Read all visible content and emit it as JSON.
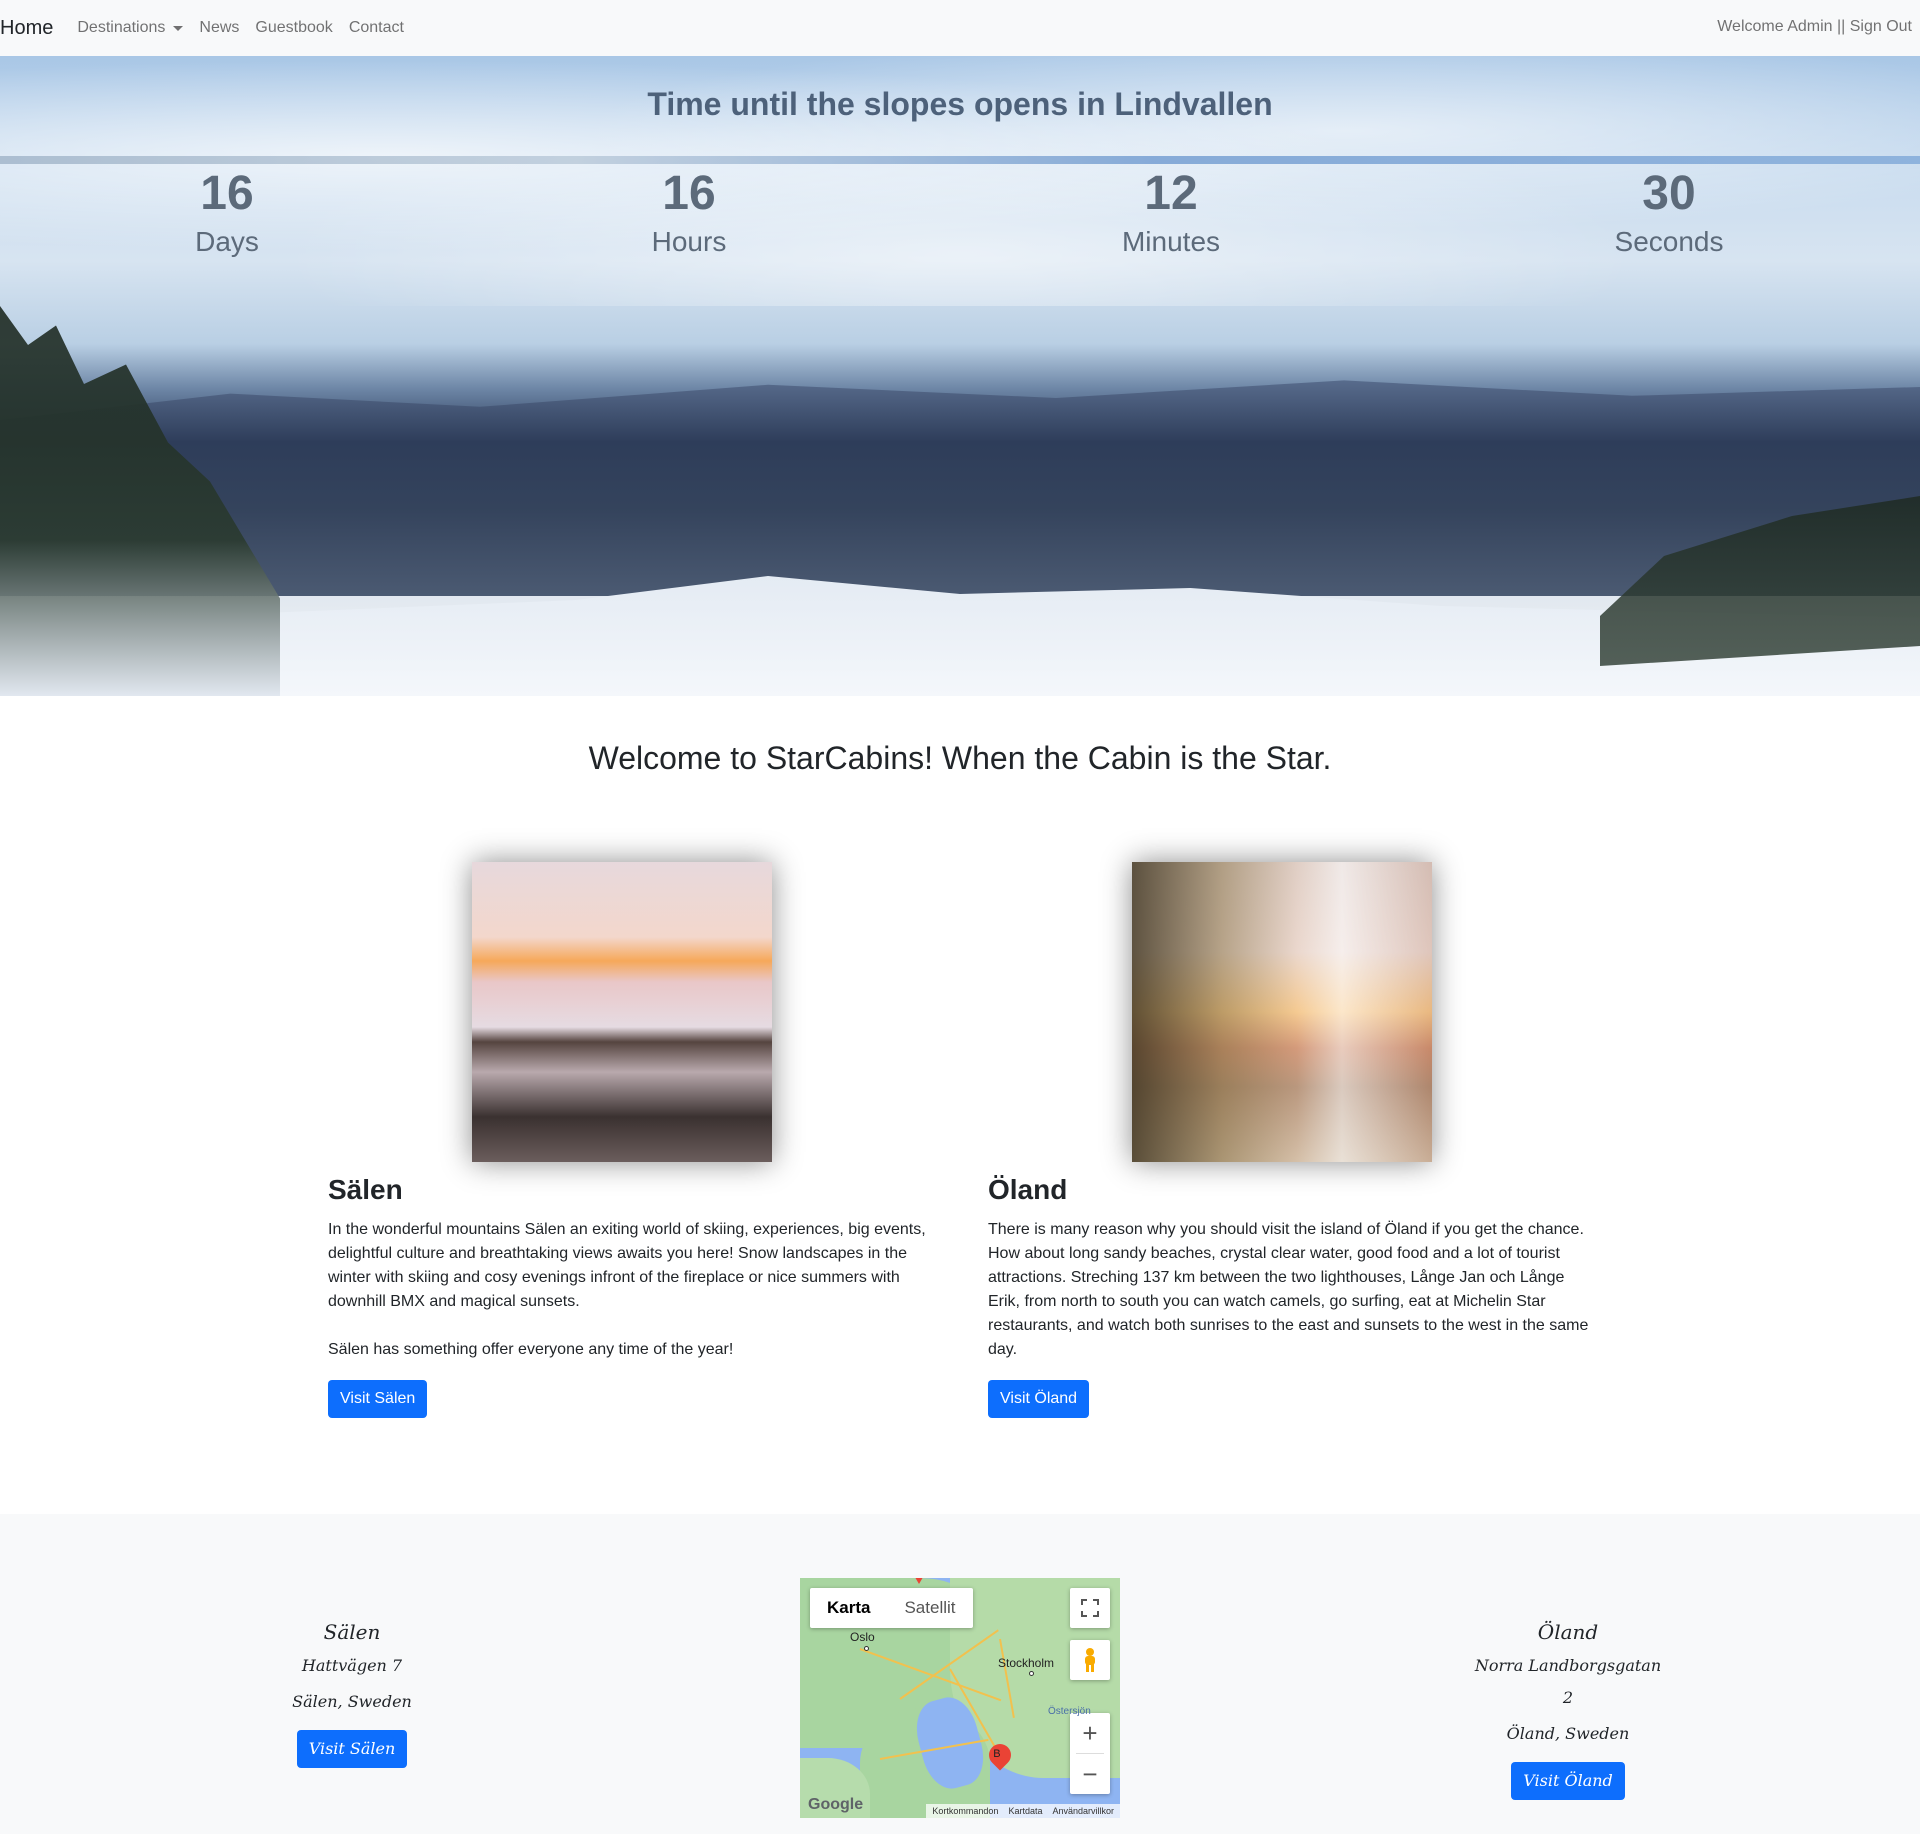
{
  "nav": {
    "brand": "Home",
    "items": [
      {
        "label": "Destinations",
        "dropdown": true
      },
      {
        "label": "News"
      },
      {
        "label": "Guestbook"
      },
      {
        "label": "Contact"
      }
    ],
    "right_text": "Welcome Admin || Sign Out"
  },
  "hero": {
    "title": "Time until the slopes opens in Lindvallen",
    "countdown": [
      {
        "value": "16",
        "label": "Days"
      },
      {
        "value": "16",
        "label": "Hours"
      },
      {
        "value": "12",
        "label": "Minutes"
      },
      {
        "value": "30",
        "label": "Seconds"
      }
    ]
  },
  "welcome": "Welcome to StarCabins! When the Cabin is the Star.",
  "destinations": [
    {
      "title": "Sälen",
      "paragraphs": [
        "In the wonderful mountains Sälen an exiting world of skiing, experiences, big events, delightful culture and breathtaking views awaits you here! Snow landscapes in the winter with skiing and cosy evenings infront of the fireplace or nice summers with downhill BMX and magical sunsets.",
        "Sälen has something offer everyone any time of the year!"
      ],
      "button": "Visit Sälen"
    },
    {
      "title": "Öland",
      "paragraphs": [
        "There is many reason why you should visit the island of Öland if you get the chance. How about long sandy beaches, crystal clear water, good food and a lot of tourist attractions. Streching 137 km between the two lighthouses, Långe Jan och Långe Erik, from north to south you can watch camels, go surfing, eat at Michelin Star restaurants, and watch both sunrises to the east and sunsets to the west in the same day."
      ],
      "button": "Visit Öland"
    }
  ],
  "footer": {
    "left": {
      "name": "Sälen",
      "street": "Hattvägen 7",
      "city": "Sälen, Sweden",
      "button": "Visit Sälen"
    },
    "right": {
      "name": "Öland",
      "street": "Norra Landborgsgatan 2",
      "city": "Öland, Sweden",
      "button": "Visit Öland"
    },
    "map": {
      "tabs": [
        "Karta",
        "Satellit"
      ],
      "labels": {
        "oslo": "Oslo",
        "stockholm": "Stockholm",
        "sea": "Östersjön"
      },
      "marker": "B",
      "logo": "Google",
      "attribution": [
        "Kortkommandon",
        "Kartdata",
        "Användarvillkor"
      ],
      "icons": {
        "fullscreen": "fullscreen-icon",
        "pegman": "pegman-icon",
        "zoom_in": "plus-icon",
        "zoom_out": "minus-icon"
      }
    }
  }
}
